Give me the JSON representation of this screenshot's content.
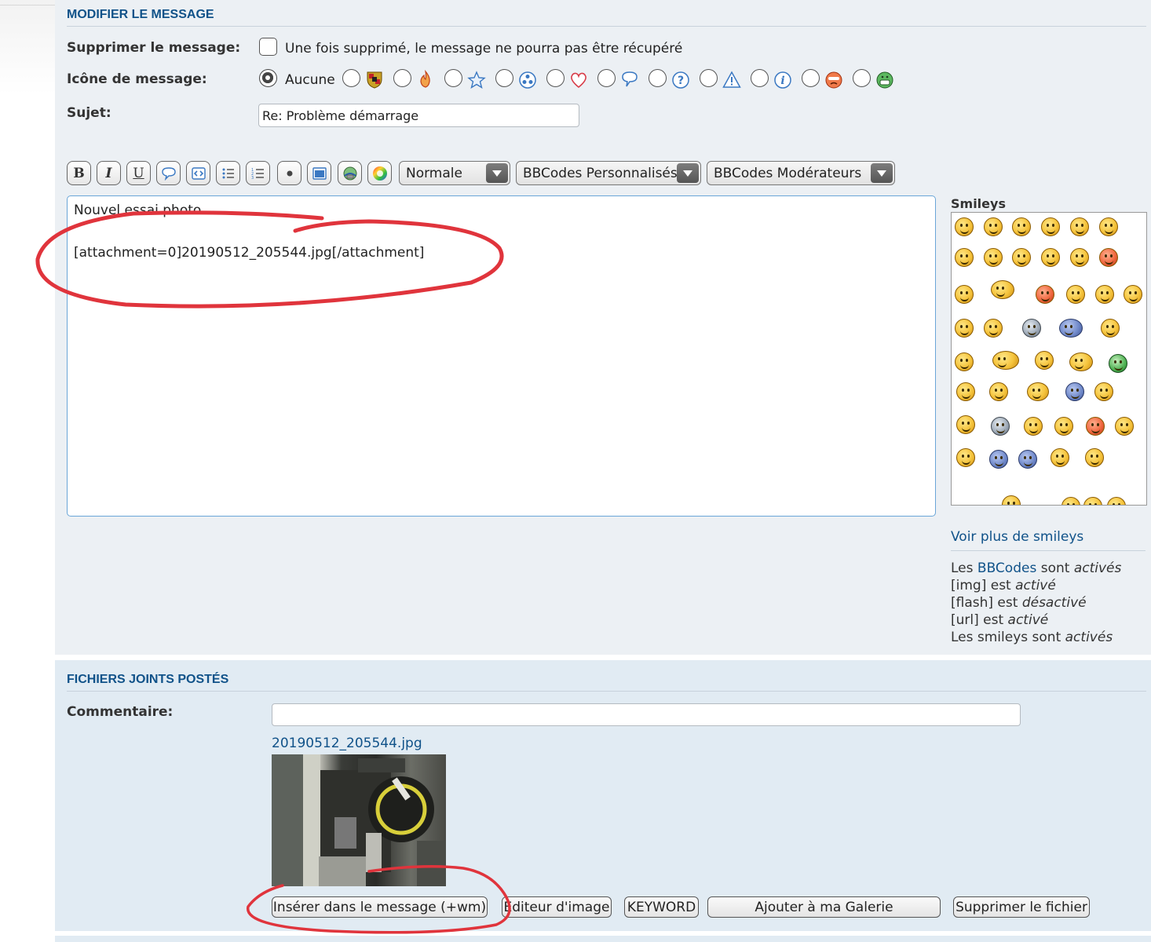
{
  "edit_section": {
    "title": "MODIFIER LE MESSAGE",
    "delete_label": "Supprimer le message:",
    "delete_note": "Une fois supprimé, le message ne pourra pas être récupéré",
    "icon_label": "Icône de message:",
    "icon_none": "Aucune",
    "icons": [
      "porsche-crest-icon",
      "flame-icon",
      "star-icon",
      "radioactive-icon",
      "heart-icon",
      "speech-bubble-icon",
      "question-icon",
      "warning-icon",
      "info-icon",
      "angry-face-icon",
      "grin-face-icon"
    ],
    "subject_label": "Sujet:",
    "subject_value": "Re: Problème démarrage"
  },
  "toolbar": {
    "buttons": [
      "bold",
      "italic",
      "underline",
      "quote",
      "code",
      "list",
      "numbered-list",
      "list-item",
      "image",
      "url",
      "color-picker"
    ],
    "bold_glyph": "B",
    "italic_glyph": "I",
    "underline_glyph": "U",
    "size_select": "Normale",
    "custom_bbcodes_select": "BBCodes Personnalisés",
    "mod_bbcodes_select": "BBCodes Modérateurs"
  },
  "editor": {
    "line1": "Nouvel essai photo",
    "line2": "[attachment=0]20190512_205544.jpg[/attachment]"
  },
  "smileys": {
    "title": "Smileys",
    "more_link": "Voir plus de smileys",
    "status": {
      "bbcodes_prefix": "Les ",
      "bbcodes_link": "BBCodes",
      "bbcodes_mid": " sont ",
      "bbcodes_state": "activés",
      "img_prefix": "[img] est ",
      "img_state": "activé",
      "flash_prefix": "[flash] est ",
      "flash_state": "désactivé",
      "url_prefix": "[url] est ",
      "url_state": "activé",
      "smileys_prefix": "Les smileys sont ",
      "smileys_state": "activés"
    }
  },
  "attachments": {
    "title": "FICHIERS JOINTS POSTÉS",
    "comment_label": "Commentaire:",
    "comment_value": "",
    "filename": "20190512_205544.jpg",
    "buttons": {
      "insert": "Insérer dans le message (+wm)",
      "editor": "Editeur d'image",
      "keyword": "KEYWORD",
      "gallery": "Ajouter à ma Galerie",
      "delete": "Supprimer le fichier"
    }
  },
  "colors": {
    "heading": "#105289",
    "panel": "#ecf0f4",
    "attachments_panel": "#e1ebf3",
    "annotation": "#e0343c",
    "editor_border": "#6aa6d8"
  }
}
